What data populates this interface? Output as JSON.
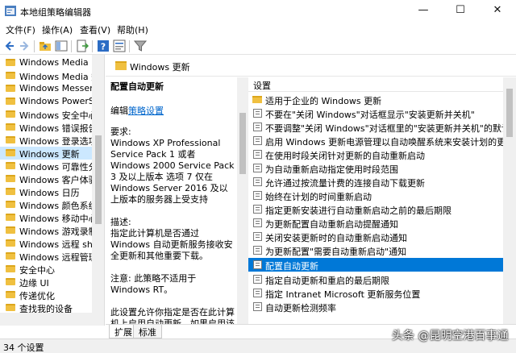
{
  "window": {
    "title": "本地组策略编辑器",
    "minimize": "—",
    "maximize": "☐",
    "close": "✕"
  },
  "menu": [
    "文件(F)",
    "操作(A)",
    "查看(V)",
    "帮助(H)"
  ],
  "tree": {
    "items": [
      "Windows Media Pl",
      "Windows Media 数",
      "Windows Messeng",
      "Windows PowerSh",
      "Windows 安全中心",
      "Windows 错误报告",
      "Windows 登录选项",
      "Windows 更新",
      "Windows 可靠性分",
      "Windows 客户体验",
      "Windows 日历",
      "Windows 颜色系统",
      "Windows 移动中心",
      "Windows 游戏录制",
      "Windows 远程 shel",
      "Windows 远程管理(",
      "安全中心",
      "边缘 UI",
      "传递优化",
      "查找我的设备"
    ],
    "selected_index": 7
  },
  "details": {
    "header": "Windows 更新",
    "desc_title": "配置自动更新",
    "desc_edit_prefix": "编辑",
    "desc_edit_link": "策略设置",
    "requirements_label": "要求:",
    "requirements_text": "Windows XP Professional Service Pack 1 或者 Windows 2000 Service Pack 3 及以上版本 选项 7 仅在 Windows Server 2016 及以上版本的服务器上受支持",
    "description_label": "描述:",
    "description_text": "指定此计算机是否通过 Windows 自动更新服务接收安全更新和其他重要下载。",
    "note_text": "注意: 此策略不适用于 Windows RT。",
    "extra_text": "此设置允许你指定是否在此计算机上启用自动更新。如果启用该服务",
    "list_header": "设置",
    "rows": [
      "适用于企业的 Windows 更新",
      "不要在\"关闭 Windows\"对话框显示\"安装更新并关机\"",
      "不要调整\"关闭 Windows\"对话框里的\"安装更新并关机\"的默认选项",
      "启用 Windows 更新电源管理以自动唤醒系统来安装计划的更新",
      "在使用时段关闭针对更新的自动重新启动",
      "为自动重新启动指定使用时段范围",
      "允许通过按流量计费的连接自动下载更新",
      "始终在计划的时间重新启动",
      "指定更新安装进行自动重新启动之前的最后期限",
      "为更新配置自动重新启动提醒通知",
      "关闭安装更新时的自动重新启动通知",
      "为更新配置\"需要自动重新启动\"通知",
      "配置自动更新",
      "指定自动更新和重启的最后期限",
      "指定 Intranet Microsoft 更新服务位置",
      "自动更新检测频率"
    ],
    "selected_row": 12
  },
  "tabs": [
    "扩展",
    "标准"
  ],
  "status": "34 个设置",
  "watermark": "头条 @昆明空港百事通"
}
